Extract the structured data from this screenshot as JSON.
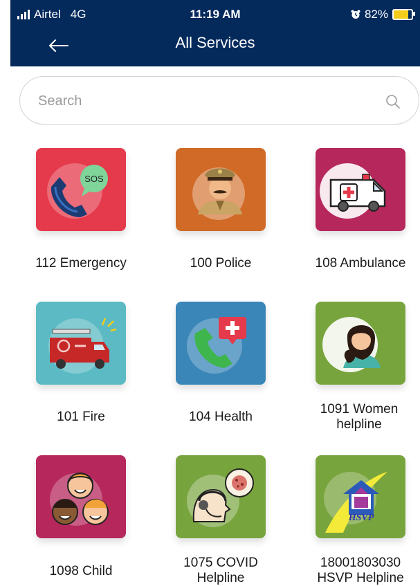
{
  "status": {
    "carrier": "Airtel",
    "network": "4G",
    "time": "11:19 AM",
    "battery": "82%",
    "battery_level": 0.82
  },
  "header": {
    "back_icon": "arrow-left-icon",
    "title": "All Services"
  },
  "search": {
    "placeholder": "Search",
    "value": "",
    "icon": "search-icon"
  },
  "colors": {
    "header_bg": "#042a5c",
    "battery": "#f4cd1a"
  },
  "services": [
    {
      "label": "112 Emergency",
      "icon": "emergency-sos-icon",
      "color": "#e53a4b"
    },
    {
      "label": "100 Police",
      "icon": "police-officer-icon",
      "color": "#d06a26"
    },
    {
      "label": "108 Ambulance",
      "icon": "ambulance-icon",
      "color": "#b6275c"
    },
    {
      "label": "101 Fire",
      "icon": "fire-truck-icon",
      "color": "#5bbac3"
    },
    {
      "label": "104 Health",
      "icon": "health-call-icon",
      "color": "#3a86b8"
    },
    {
      "label": "1091 Women helpline",
      "icon": "woman-icon",
      "color": "#78a43d"
    },
    {
      "label": "1098 Child",
      "icon": "children-icon",
      "color": "#b6275c"
    },
    {
      "label": "1075 COVID Helpline",
      "icon": "covid-helpline-icon",
      "color": "#78a43d"
    },
    {
      "label": "18001803030 HSVP Helpline",
      "icon": "hsvp-logo-icon",
      "color": "#78a43d",
      "logo_text": "HSVP"
    }
  ]
}
